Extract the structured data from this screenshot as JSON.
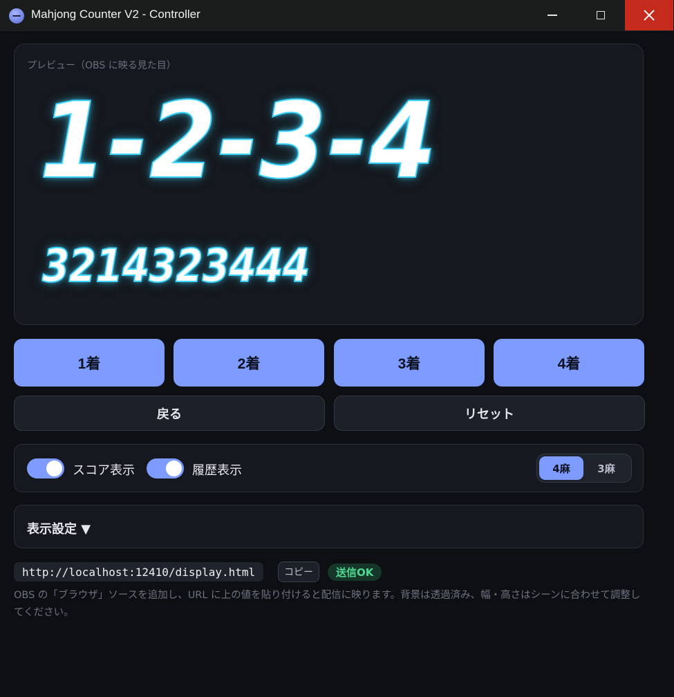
{
  "window": {
    "title": "Mahjong Counter V2 - Controller"
  },
  "preview": {
    "label": "プレビュー（OBS に映る見た目）",
    "current_order": "1-2-3-4",
    "history": "3214323444"
  },
  "place_buttons": [
    "1着",
    "2着",
    "3着",
    "4着"
  ],
  "actions": {
    "back": "戻る",
    "reset": "リセット"
  },
  "toggles": {
    "score": {
      "label": "スコア表示",
      "on": true
    },
    "history": {
      "label": "履歴表示",
      "on": true
    }
  },
  "mode": {
    "options": [
      "4麻",
      "3麻"
    ],
    "selected": "4麻"
  },
  "display_settings": {
    "label": "表示設定 ▼"
  },
  "url": {
    "value": "http://localhost:12410/display.html",
    "copy_label": "コピー",
    "status": "送信OK"
  },
  "help_text": "OBS の「ブラウザ」ソースを追加し、URL に上の値を貼り付けると配信に映ります。背景は透過済み、幅・高さはシーンに合わせて調整してください。",
  "colors": {
    "accent": "#7e9cff",
    "glow": "#3fd6ff",
    "close": "#c42b1c",
    "ok": "#4fd88f"
  }
}
